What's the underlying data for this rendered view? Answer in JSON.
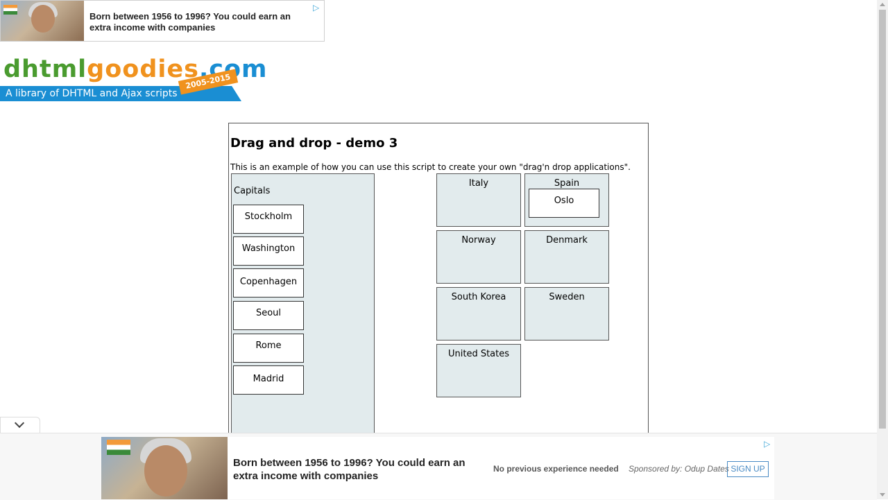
{
  "top_ad": {
    "headline": "Born between 1956 to 1996? You could earn an extra income with companies"
  },
  "logo": {
    "name_part1": "dhtml",
    "name_part2": "goodies",
    "name_part3": ".com",
    "tagline": "A library of DHTML and Ajax scripts",
    "years": "2005-2015"
  },
  "demo": {
    "title": "Drag and drop - demo 3",
    "intro": "This is an example of how you can use this script to create your own \"drag'n drop applications\".",
    "capitals_label": "Capitals",
    "capitals": [
      "Stockholm",
      "Washington",
      "Copenhagen",
      "Seoul",
      "Rome",
      "Madrid"
    ],
    "countries": [
      {
        "name": "Italy",
        "dropped": ""
      },
      {
        "name": "Spain",
        "dropped": "Oslo"
      },
      {
        "name": "Norway",
        "dropped": ""
      },
      {
        "name": "Denmark",
        "dropped": ""
      },
      {
        "name": "South Korea",
        "dropped": ""
      },
      {
        "name": "Sweden",
        "dropped": ""
      },
      {
        "name": "United States",
        "dropped": ""
      }
    ]
  },
  "bottom_ad": {
    "headline": "Born between 1956 to 1996? You could earn an extra income with companies",
    "subtext": "No previous experience needed",
    "sponsor": "Sponsored by: Odup Dates",
    "cta": "SIGN UP"
  },
  "colors": {
    "dropzone_bg": "#e2ebed",
    "logo_green": "#4a9b2f",
    "logo_orange": "#f0921e",
    "logo_blue": "#1a8ed3"
  },
  "icons": [
    "ad-choices-icon",
    "chevron-down-icon"
  ]
}
